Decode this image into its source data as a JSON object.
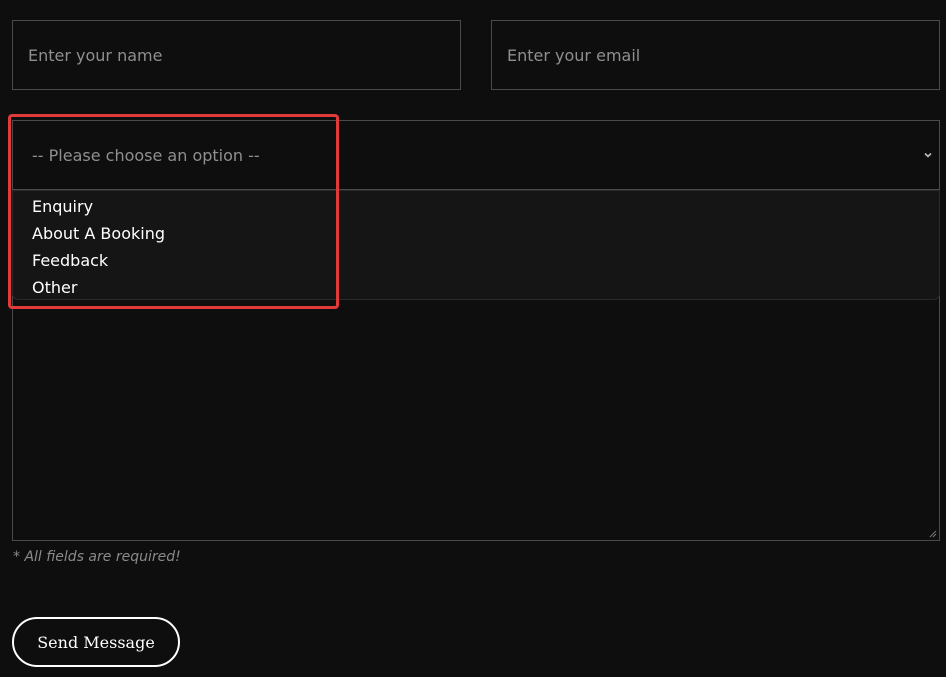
{
  "form": {
    "name_placeholder": "Enter your name",
    "email_placeholder": "Enter your email",
    "subject": {
      "selected": "-- Please choose an option --",
      "options": [
        "Enquiry",
        "About A Booking",
        "Feedback",
        "Other"
      ]
    },
    "required_note": "* All fields are required!",
    "send_label": "Send Message"
  },
  "colors": {
    "background": "#0e0e0e",
    "border": "#4a4a4a",
    "placeholder": "#8f8f8f",
    "highlight": "#e03a3a",
    "text": "#ffffff"
  },
  "icons": {
    "select_arrow": "chevron-down-icon",
    "resize_handle": "resize-handle-icon"
  }
}
